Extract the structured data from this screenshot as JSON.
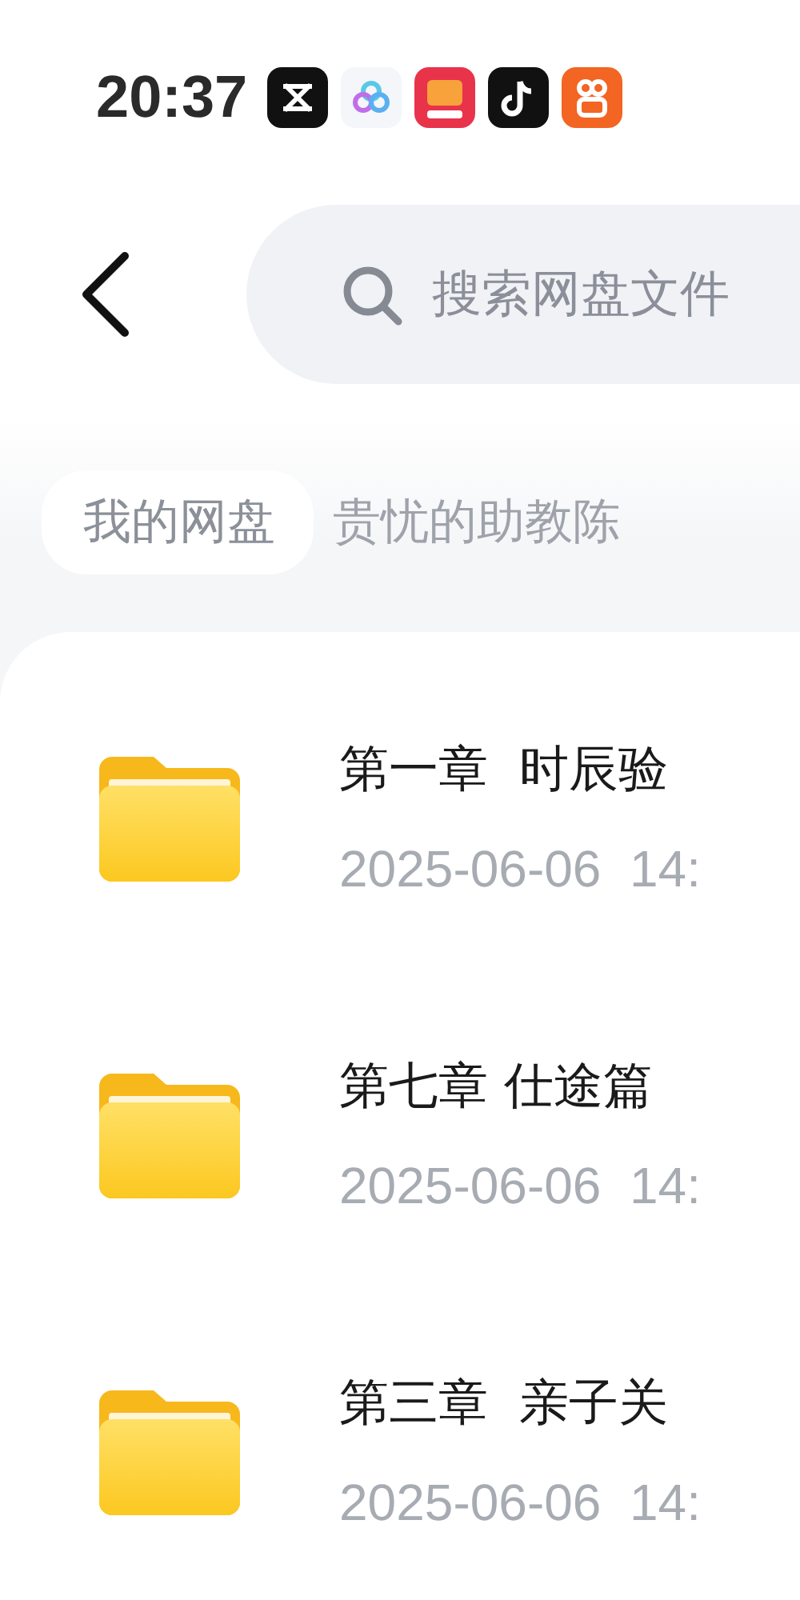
{
  "status_bar": {
    "time": "20:37",
    "app_icons": [
      {
        "kind": "capcut",
        "color": "#111111"
      },
      {
        "kind": "cloud",
        "color": "#f4f6fa"
      },
      {
        "kind": "taobao",
        "color": "#e8334a"
      },
      {
        "kind": "music",
        "color": "#111111"
      },
      {
        "kind": "camera",
        "color": "#f26522"
      }
    ]
  },
  "search": {
    "placeholder": "搜索网盘文件"
  },
  "breadcrumb": [
    {
      "label": "我的网盘",
      "selected": true
    },
    {
      "label": "贵忧的助教陈",
      "selected": false
    }
  ],
  "files": [
    {
      "name": "第一章  时辰验",
      "date": "2025-06-06  14:"
    },
    {
      "name": "第七章 仕途篇",
      "date": "2025-06-06  14:"
    },
    {
      "name": "第三章  亲子关",
      "date": "2025-06-06  14:"
    }
  ]
}
